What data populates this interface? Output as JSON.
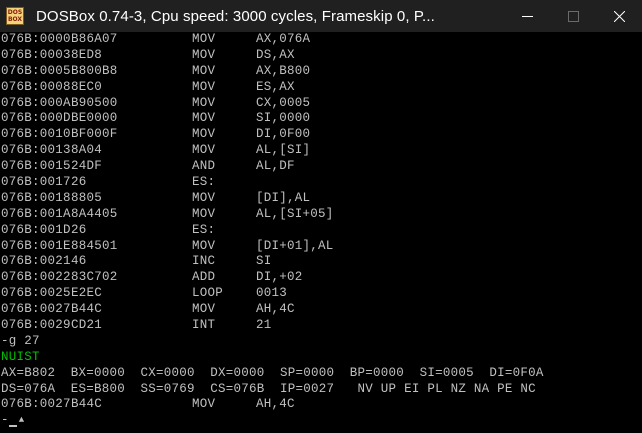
{
  "titlebar": {
    "icon_lines": [
      "DOS",
      "BOX"
    ],
    "title": "DOSBox 0.74-3, Cpu speed:     3000 cycles, Frameskip  0, P...",
    "minimize_icon": "minimize-icon",
    "maximize_icon": "maximize-icon",
    "close_icon": "close-icon"
  },
  "console": {
    "disasm": [
      {
        "addr": "076B:0000",
        "hex": "B86A07",
        "mnemonic": "MOV",
        "operands": "AX,076A"
      },
      {
        "addr": "076B:0003",
        "hex": "8ED8",
        "mnemonic": "MOV",
        "operands": "DS,AX"
      },
      {
        "addr": "076B:0005",
        "hex": "B800B8",
        "mnemonic": "MOV",
        "operands": "AX,B800"
      },
      {
        "addr": "076B:0008",
        "hex": "8EC0",
        "mnemonic": "MOV",
        "operands": "ES,AX"
      },
      {
        "addr": "076B:000A",
        "hex": "B90500",
        "mnemonic": "MOV",
        "operands": "CX,0005"
      },
      {
        "addr": "076B:000D",
        "hex": "BE0000",
        "mnemonic": "MOV",
        "operands": "SI,0000"
      },
      {
        "addr": "076B:0010",
        "hex": "BF000F",
        "mnemonic": "MOV",
        "operands": "DI,0F00"
      },
      {
        "addr": "076B:0013",
        "hex": "8A04",
        "mnemonic": "MOV",
        "operands": "AL,[SI]"
      },
      {
        "addr": "076B:0015",
        "hex": "24DF",
        "mnemonic": "AND",
        "operands": "AL,DF"
      },
      {
        "addr": "076B:0017",
        "hex": "26",
        "mnemonic": "ES:",
        "operands": ""
      },
      {
        "addr": "076B:0018",
        "hex": "8805",
        "mnemonic": "MOV",
        "operands": "[DI],AL"
      },
      {
        "addr": "076B:001A",
        "hex": "8A4405",
        "mnemonic": "MOV",
        "operands": "AL,[SI+05]"
      },
      {
        "addr": "076B:001D",
        "hex": "26",
        "mnemonic": "ES:",
        "operands": ""
      },
      {
        "addr": "076B:001E",
        "hex": "884501",
        "mnemonic": "MOV",
        "operands": "[DI+01],AL"
      },
      {
        "addr": "076B:0021",
        "hex": "46",
        "mnemonic": "INC",
        "operands": "SI"
      },
      {
        "addr": "076B:0022",
        "hex": "83C702",
        "mnemonic": "ADD",
        "operands": "DI,+02"
      },
      {
        "addr": "076B:0025",
        "hex": "E2EC",
        "mnemonic": "LOOP",
        "operands": "0013"
      },
      {
        "addr": "076B:0027",
        "hex": "B44C",
        "mnemonic": "MOV",
        "operands": "AH,4C"
      },
      {
        "addr": "076B:0029",
        "hex": "CD21",
        "mnemonic": "INT",
        "operands": "21"
      }
    ],
    "command": "-g 27",
    "program_output": "NUIST",
    "registers_line1": "AX=B802  BX=0000  CX=0000  DX=0000  SP=0000  BP=0000  SI=0005  DI=0F0A",
    "registers_line2": "DS=076A  ES=B800  SS=0769  CS=076B  IP=0027   NV UP EI PL NZ NA PE NC",
    "current_instr": {
      "addr": "076B:0027",
      "hex": "B44C",
      "mnemonic": "MOV",
      "operands": "AH,4C"
    },
    "prompt": "-",
    "up_arrow": "▲",
    "colors": {
      "text": "#c0c0c0",
      "output": "#00c000",
      "titlebar": "#202020"
    }
  }
}
